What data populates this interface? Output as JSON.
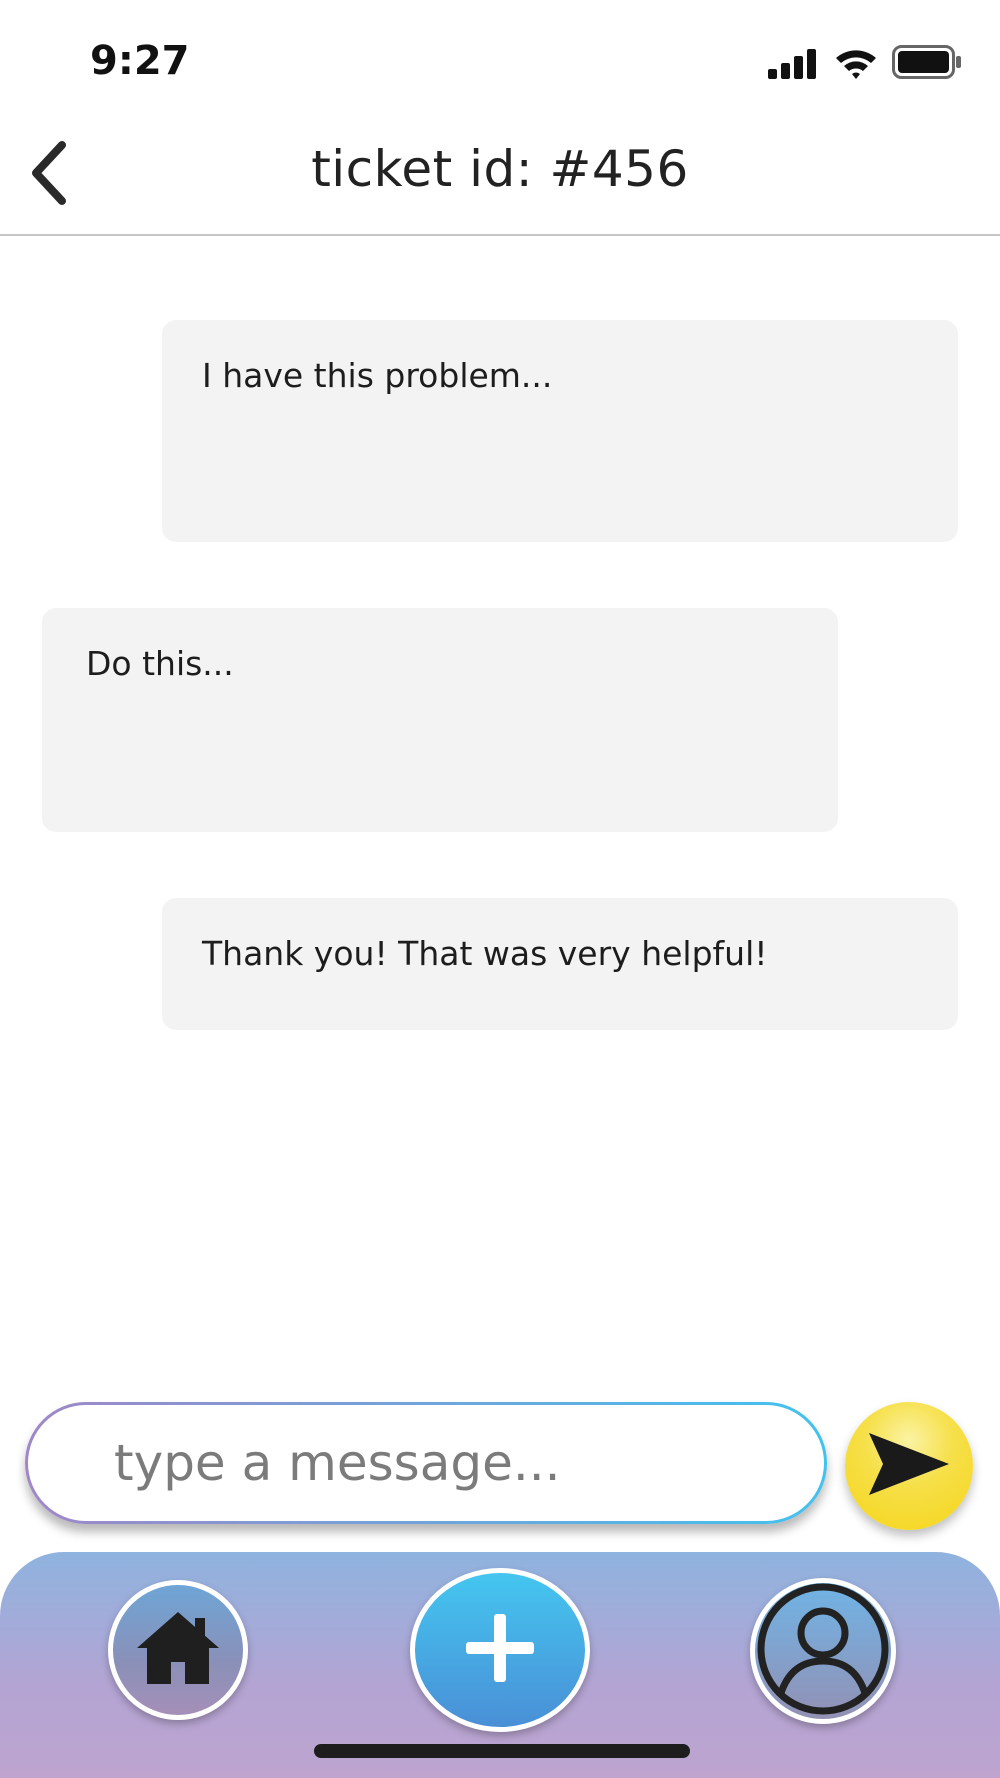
{
  "status_bar": {
    "time": "9:27",
    "icons": [
      "cellular-signal-icon",
      "wifi-icon",
      "battery-icon"
    ]
  },
  "header": {
    "title": "ticket id: #456",
    "back_icon": "chevron-left-icon"
  },
  "messages": [
    {
      "sender": "user",
      "text": "I have this problem..."
    },
    {
      "sender": "support",
      "text": "Do this..."
    },
    {
      "sender": "user",
      "text": "Thank you! That was very helpful!"
    }
  ],
  "composer": {
    "placeholder": "type a message...",
    "value": "",
    "send_icon": "send-icon"
  },
  "bottom_nav": {
    "items": [
      {
        "name": "home",
        "icon": "home-icon"
      },
      {
        "name": "add",
        "icon": "plus-icon"
      },
      {
        "name": "profile",
        "icon": "user-icon"
      }
    ]
  },
  "colors": {
    "bubble": "#f3f3f3",
    "accent_blue": "#42c2ee",
    "accent_purple": "#9f87c8",
    "send_yellow": "#f5d51a",
    "nav_top": "#8fb3df",
    "nav_bottom": "#bea4cf"
  }
}
